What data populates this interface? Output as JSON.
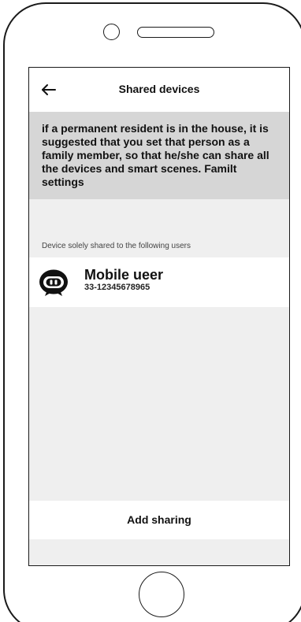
{
  "header": {
    "title": "Shared devices",
    "back_icon": "arrow-left-icon"
  },
  "notice": {
    "text": "if a permanent resident is in the house, it is suggested that you set that person as a family member, so that he/she can share all the devices and smart scenes. Familt settings"
  },
  "shared_users": {
    "section_label": "Device solely shared to the following users",
    "items": [
      {
        "name": "Mobile ueer",
        "phone": "33-12345678965",
        "avatar_icon": "robot-avatar-icon"
      }
    ]
  },
  "actions": {
    "add_sharing_label": "Add sharing"
  },
  "colors": {
    "screen_background": "#efefef",
    "notice_background": "#d6d6d6",
    "card_background": "#ffffff",
    "text": "#111111"
  }
}
